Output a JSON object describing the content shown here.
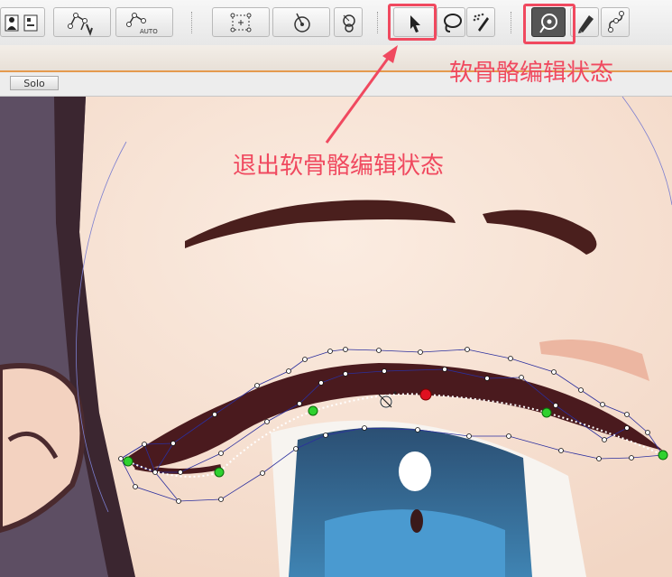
{
  "toolbar": {
    "buttons": [
      {
        "name": "layer-person-icon"
      },
      {
        "name": "bone-weight-icon"
      },
      {
        "name": "auto-bone-icon",
        "label": "AUTO"
      },
      {
        "name": "mesh-select-icon"
      },
      {
        "name": "rotate-deform-icon"
      },
      {
        "name": "deform-pin-icon"
      },
      {
        "name": "select-arrow-icon"
      },
      {
        "name": "lasso-icon"
      },
      {
        "name": "brush-icon"
      },
      {
        "name": "soft-bone-edit-icon"
      },
      {
        "name": "pen-icon"
      },
      {
        "name": "bone-link-icon"
      }
    ]
  },
  "solo_label": "Solo",
  "annotations": {
    "top_right": "软骨骼编辑状态",
    "center": "退出软骨骼编辑状态"
  },
  "colors": {
    "annotation": "#f0495f",
    "mesh_line": "#2b2f9e",
    "spline": "#ffffff",
    "control_green": "#2fd12f",
    "control_red": "#e01020",
    "skin": "#f7e2d3",
    "eyebrow": "#4a1f1d",
    "eye_blue": "#2f6a95"
  }
}
